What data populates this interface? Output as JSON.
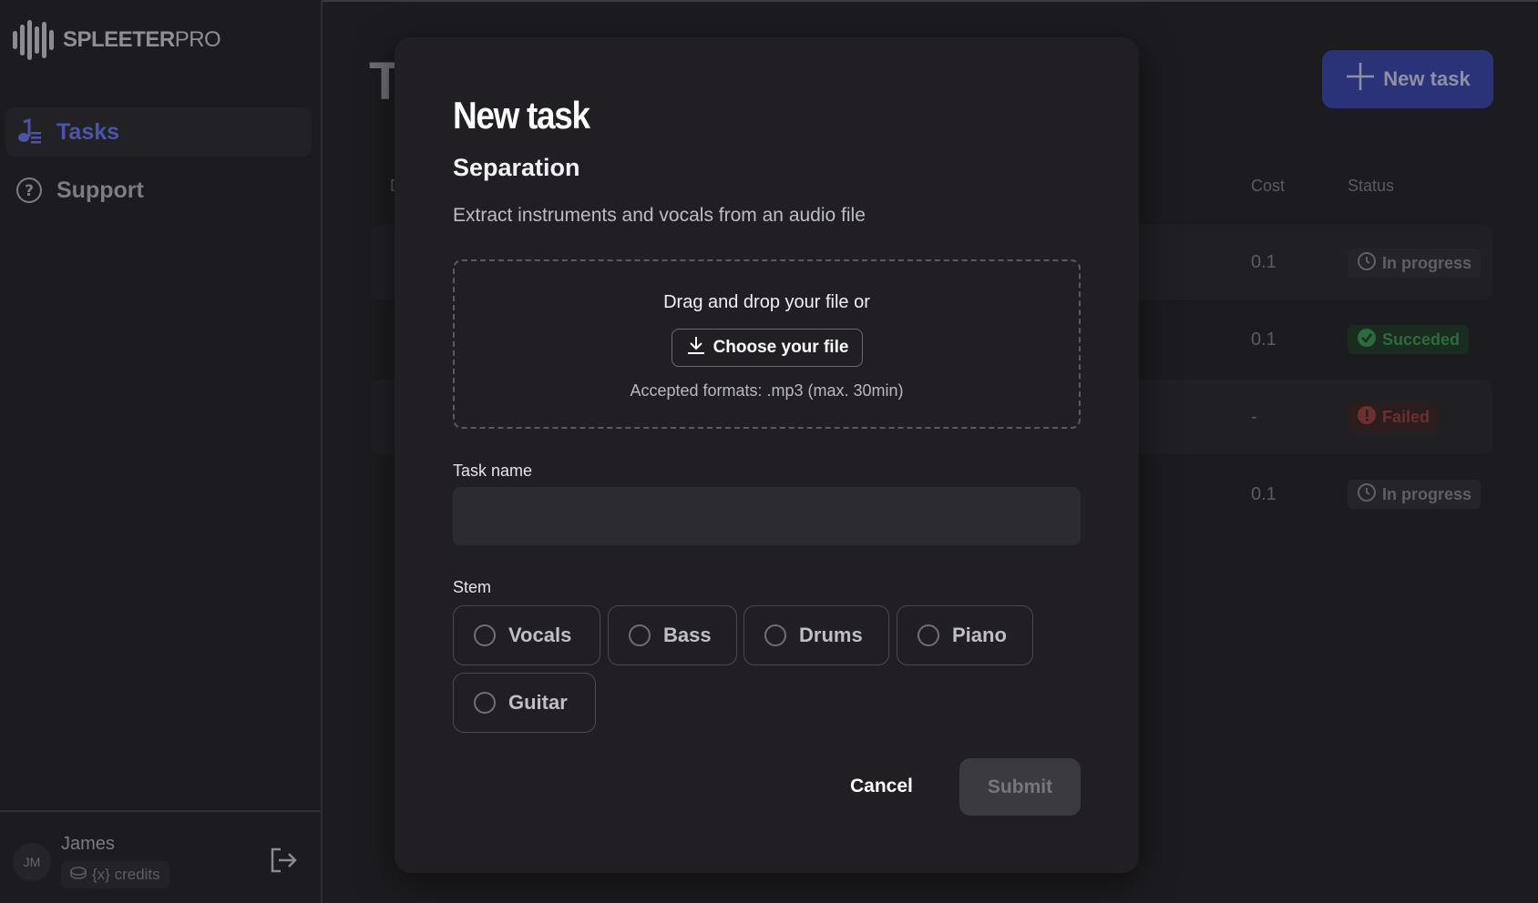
{
  "brand": {
    "name": "SPLEETER",
    "suffix": "PRO"
  },
  "sidebar": {
    "items": [
      {
        "label": "Tasks",
        "icon": "music-notes-icon",
        "active": true
      },
      {
        "label": "Support",
        "icon": "help-circle-icon",
        "active": false
      }
    ]
  },
  "user": {
    "initials": "JM",
    "name": "James",
    "credits": "{x} credits"
  },
  "main": {
    "title_visible": "Ta",
    "new_task_label": "New task",
    "column_partial": "D",
    "columns": {
      "cost": "Cost",
      "status": "Status"
    },
    "rows": [
      {
        "cost": "0.1",
        "status": "In progress",
        "status_type": "progress"
      },
      {
        "cost": "0.1",
        "status": "Succeded",
        "status_type": "success"
      },
      {
        "cost": "-",
        "status": "Failed",
        "status_type": "failed"
      },
      {
        "cost": "0.1",
        "status": "In progress",
        "status_type": "progress"
      }
    ]
  },
  "modal": {
    "title": "New task",
    "subtitle": "Separation",
    "description": "Extract instruments and vocals from an audio file",
    "dropzone": {
      "text": "Drag and drop your file or",
      "button_label": "Choose your file",
      "formats": "Accepted formats: .mp3 (max. 30min)"
    },
    "task_name": {
      "label": "Task name",
      "value": "",
      "placeholder": ""
    },
    "stem": {
      "label": "Stem",
      "options": [
        "Vocals",
        "Bass",
        "Drums",
        "Piano",
        "Guitar"
      ]
    },
    "cancel_label": "Cancel",
    "submit_label": "Submit"
  },
  "colors": {
    "accent": "#2a3378",
    "success": "#2e6b3c",
    "failed": "#6e2f30",
    "modal_bg": "#211f24"
  }
}
